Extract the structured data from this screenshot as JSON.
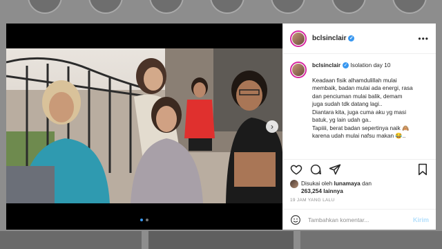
{
  "post": {
    "username": "bclsinclair",
    "more_icon": "more-horizontal-icon",
    "caption_title": "Isolation day 10",
    "caption_lines": [
      "Keadaan fisik alhamdulillah mulai",
      "membaik, badan mulai ada energi, rasa",
      "dan penciuman mulai balik, demam",
      "juga sudah tdk datang lagi..",
      "Diantara kita, juga cuma aku yg masi",
      "batuk, yg lain udah ga..",
      "Tapiiii, berat badan sepertinya naik 🙈",
      "karena udah mulai nafsu makan 😂.."
    ],
    "likes_prefix": "Disukai oleh",
    "likes_user": "lunamaya",
    "likes_and": "dan",
    "likes_count": "263,254 lainnya",
    "timestamp": "19 JAM YANG LALU",
    "comment_placeholder": "Tambahkan komentar...",
    "post_button": "Kirim",
    "next_arrow": "›"
  },
  "colors": {
    "accent": "#3897f0",
    "post_button": "#b2dffc",
    "muted": "#8e8e8e"
  }
}
